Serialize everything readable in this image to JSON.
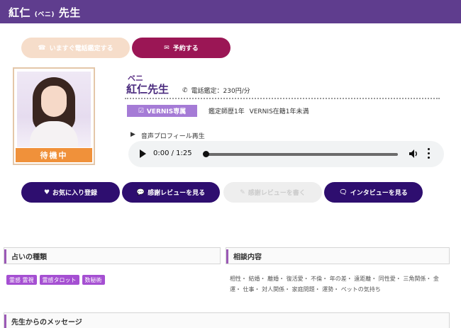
{
  "header": {
    "name": "紅仁",
    "kana_paren": "(ベニ)",
    "honorific": " 先生"
  },
  "top_buttons": {
    "phone_label": "いますぐ電話鑑定する",
    "reserve_label": "予約する"
  },
  "profile": {
    "status": "待機中",
    "kana": "ベニ",
    "name": "紅仁先生",
    "fee": "電話鑑定：230円/分",
    "badge": "VERNIS専属",
    "career": "鑑定師歴1年 VERNIS在籍1年未満"
  },
  "voice": {
    "label": "音声プロフィール再生",
    "time": "0:00 / 1:25",
    "progress": 0
  },
  "actions": {
    "favorite": "お気に入り登録",
    "reviews": "感謝レビューを見る",
    "write_review": "感謝レビューを書く",
    "interview": "インタビューを見る"
  },
  "sections": {
    "types_title": "占いの種類",
    "consult_title": "相談内容",
    "message_title": "先生からのメッセージ"
  },
  "fortune_types": [
    "霊感 霊視",
    "霊感タロット",
    "数秘術"
  ],
  "consult_content": "相性・ 結婚・ 離婚・ 復活愛・ 不倫・ 年の差・ 遠距離・ 同性愛・ 三角関係・ 金運・ 仕事・ 対人関係・ 家庭問題・ 運勢・ ペットの気持ち",
  "colors": {
    "header_bg": "#5f3d8e",
    "action_bg": "#2e0e6f",
    "reserve_bg": "#9b1655",
    "tag_bg": "#a54fd2",
    "waiting_bg": "#f0913a"
  }
}
